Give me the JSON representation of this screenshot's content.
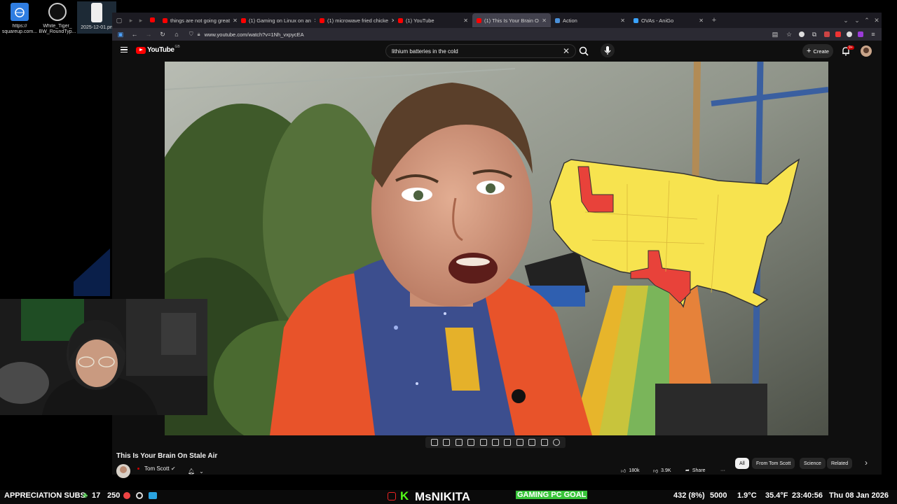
{
  "desktop": {
    "icons": [
      {
        "label_1": "https://",
        "label_2": "squareup.com...",
        "icon": "web-link-icon"
      },
      {
        "label_1": "White_Tiger_",
        "label_2": "BW_RoundTyp...",
        "icon": "image-file-icon"
      },
      {
        "label_1": "2025-12-01.pn",
        "label_2": "",
        "icon": "png-file-icon"
      }
    ]
  },
  "browser": {
    "tabs": [
      {
        "label": "things are not going great",
        "favicon_color": "#ff0000",
        "active": false
      },
      {
        "label": "(1) Gaming on Linux on an",
        "favicon_color": "#ff0000",
        "active": false
      },
      {
        "label": "(1) microwave fried chicke",
        "favicon_color": "#ff0000",
        "active": false
      },
      {
        "label": "(1) YouTube",
        "favicon_color": "#ff0000",
        "active": false
      },
      {
        "label": "(1) This Is Your Brain O",
        "favicon_color": "#ff0000",
        "active": true
      },
      {
        "label": "Action",
        "favicon_color": "#4a90d9",
        "active": false
      },
      {
        "label": "OVAs - AniGo",
        "favicon_color": "#3aa3ff",
        "active": false
      }
    ],
    "url": "www.youtube.com/watch?v=1Nh_vxpycEA"
  },
  "youtube": {
    "logo_text": "YouTube",
    "country_code": "GB",
    "search_value": "lithium batteries in the cold",
    "create_label": "Create",
    "notification_count": "9+",
    "video_title": "This Is Your Brain On Stale Air",
    "channel_name": "Tom Scott",
    "likes": "180k",
    "dislikes": "3.9K",
    "share_label": "Share",
    "chips": [
      "All",
      "From Tom Scott",
      "Science",
      "Related"
    ],
    "map_colors": {
      "base": "#f7e34f",
      "highlight": "#e8423a"
    }
  },
  "taskbar": {
    "appreciation": "APPRECIATION SUBS",
    "left_count_1": "17",
    "left_count_2": "250",
    "streamer_name": "MsNIKITA",
    "goal_label": "GAMING PC GOAL",
    "cpu": "432 (8%)",
    "points": "5000",
    "temp": "1.9°C",
    "temp_f": "35.4°F",
    "time": "23:40:56",
    "date": "Thu 08 Jan 2026"
  }
}
